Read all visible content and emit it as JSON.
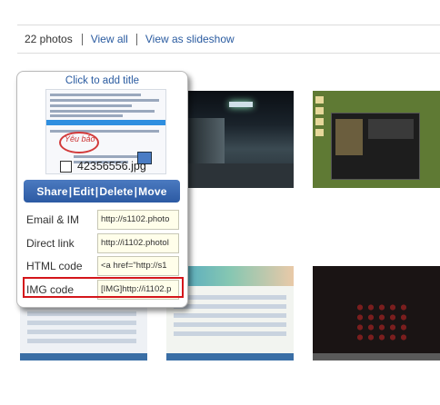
{
  "toolbar": {
    "count": "22 photos",
    "view_all": "View all",
    "view_slideshow": "View as slideshow"
  },
  "popup": {
    "title": "Click to add title",
    "filename": "42356556.jpg",
    "preview_caption": "Yêu bảo",
    "actions": {
      "share": "Share",
      "edit": "Edit",
      "delete": "Delete",
      "move": "Move",
      "separator": "|"
    },
    "fields": [
      {
        "label": "Email & IM",
        "value": "http://s1102.photo"
      },
      {
        "label": "Direct link",
        "value": "http://i1102.photol"
      },
      {
        "label": "HTML code",
        "value": "<a href=\"http://s1"
      },
      {
        "label": "IMG code",
        "value": "[IMG]http://i1102.p"
      }
    ]
  },
  "colors": {
    "link": "#2a5ba0",
    "action_bar": "#2c5aa3",
    "highlight": "#d4161b",
    "field_bg": "#fffeea"
  }
}
